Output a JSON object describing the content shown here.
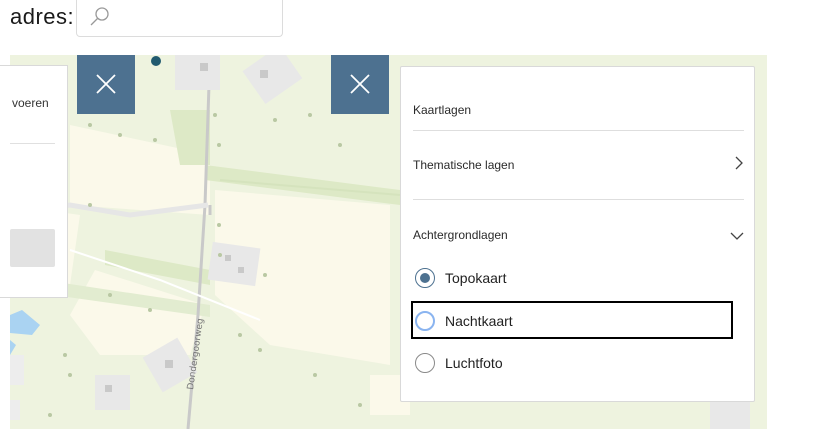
{
  "header": {
    "address_label": "adres:",
    "search_icon": "search-icon"
  },
  "left_panel": {
    "partial_text": "voeren"
  },
  "close_buttons": {
    "icon": "close-icon"
  },
  "map": {
    "road_label": "Dondergoorweg"
  },
  "layers_panel": {
    "title": "Kaartlagen",
    "thematic_label": "Thematische lagen",
    "thematic_icon": "chevron-right-icon",
    "background_label": "Achtergrondlagen",
    "background_icon": "chevron-down-icon",
    "options": [
      {
        "label": "Topokaart",
        "checked": true
      },
      {
        "label": "Nachtkaart",
        "checked": false
      },
      {
        "label": "Luchtfoto",
        "checked": false
      }
    ]
  },
  "colors": {
    "accent": "#4d7190",
    "map_background": "#eef3df",
    "focus_ring": "#8ab4f0"
  }
}
